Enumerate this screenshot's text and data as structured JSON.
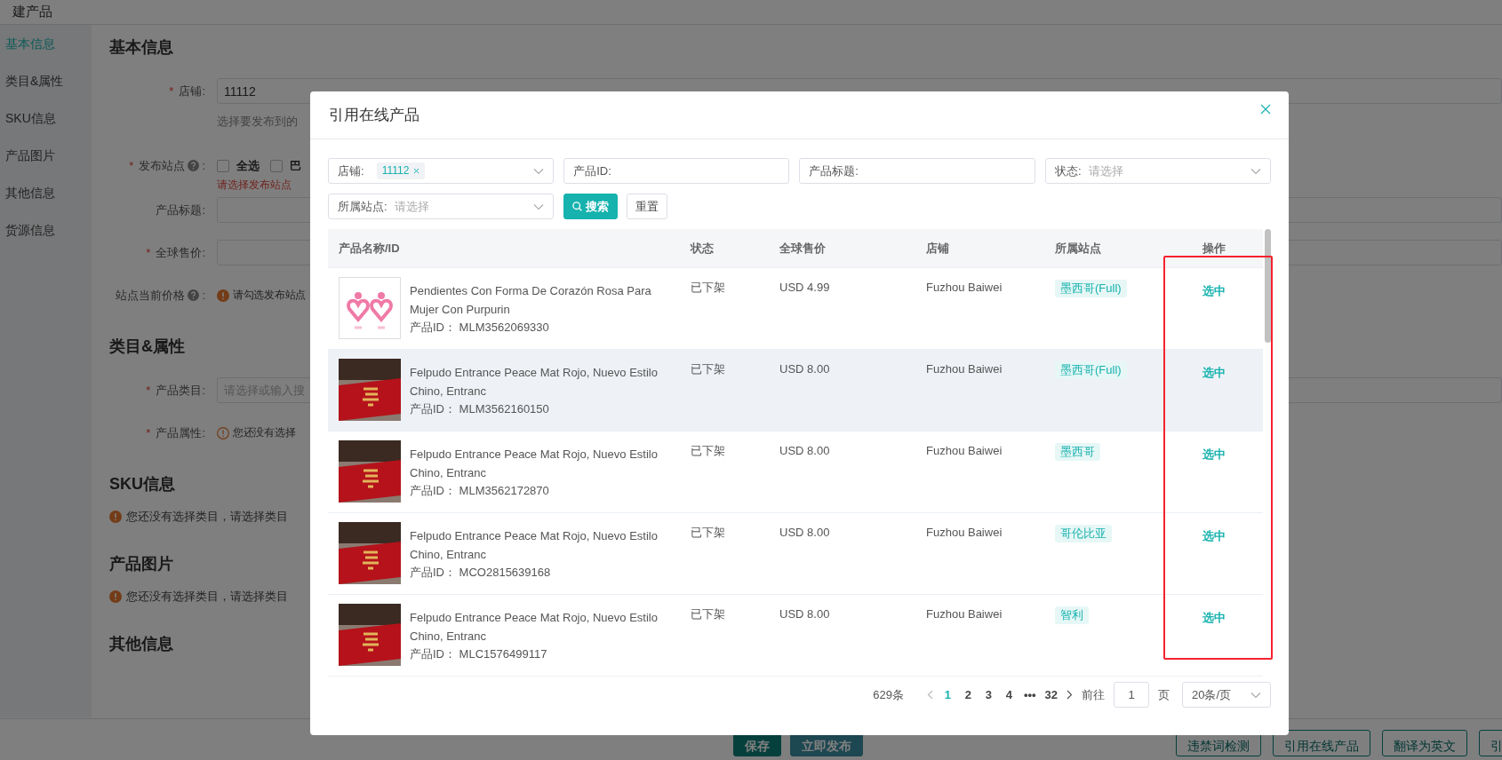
{
  "page": {
    "title": "建产品"
  },
  "sidebar": {
    "items": [
      {
        "label": "基本信息",
        "selected": true
      },
      {
        "label": "类目&属性",
        "selected": false
      },
      {
        "label": "SKU信息",
        "selected": false
      },
      {
        "label": "产品图片",
        "selected": false
      },
      {
        "label": "其他信息",
        "selected": false
      },
      {
        "label": "货源信息",
        "selected": false
      }
    ]
  },
  "form": {
    "sections": [
      {
        "title": "基本信息",
        "fields": [
          {
            "kind": "input",
            "mark": "*",
            "label": "店铺:",
            "help": false,
            "value": "11112",
            "hint": "选择要发布到的"
          },
          {
            "kind": "checkboxes",
            "mark": "*",
            "label": "发布站点",
            "help": true,
            "colon": ":",
            "options": [
              {
                "label": "全选",
                "checked": false
              },
              {
                "label": "巴",
                "checked": false
              }
            ],
            "error": "请选择发布站点"
          },
          {
            "kind": "input",
            "label": "产品标题:",
            "help": false
          },
          {
            "kind": "input",
            "mark": "*",
            "label": "全球售价:",
            "help": false
          },
          {
            "kind": "notice",
            "label": "站点当前价格",
            "help": true,
            "colon": ":",
            "text": "请勾选发布站点"
          }
        ]
      },
      {
        "title": "类目&属性",
        "fields": [
          {
            "kind": "input",
            "mark": "*",
            "label": "产品类目:",
            "help": false,
            "placeholder": "请选择或输入搜"
          },
          {
            "kind": "notice",
            "mark": "*",
            "label": "产品属性:",
            "help": false,
            "text": "您还没有选择"
          }
        ]
      },
      {
        "title": "SKU信息",
        "notice": "您还没有选择类目，请选择类目"
      },
      {
        "title": "产品图片",
        "notice": "您还没有选择类目，请选择类目"
      },
      {
        "title": "其他信息"
      }
    ]
  },
  "bottom_bar": {
    "buttons": [
      {
        "label": "保存",
        "kind": "primary"
      },
      {
        "label": "立即发布",
        "kind": "light"
      }
    ],
    "right_buttons": [
      {
        "label": "违禁词检测",
        "kind": "outline"
      },
      {
        "label": "引用在线产品",
        "kind": "outline"
      },
      {
        "label": "翻译为英文",
        "kind": "outline"
      },
      {
        "label": "引",
        "kind": "outline"
      }
    ]
  },
  "dialog": {
    "title": "引用在线产品",
    "filters": [
      {
        "kind": "select",
        "label": "店铺:",
        "tags": [
          "11112"
        ]
      },
      {
        "kind": "input",
        "label": "产品ID:"
      },
      {
        "kind": "input",
        "label": "产品标题:"
      },
      {
        "kind": "select",
        "label": "状态:",
        "placeholder": "请选择"
      },
      {
        "kind": "select",
        "label": "所属站点:",
        "placeholder": "请选择"
      }
    ],
    "buttons": [
      {
        "label": "搜索",
        "kind": "primary"
      },
      {
        "label": "重置",
        "kind": "default"
      }
    ],
    "table": {
      "columns": [
        "产品名称/ID",
        "状态",
        "全球售价",
        "店铺",
        "所属站点",
        "操作"
      ],
      "rows": [
        {
          "name": "Pendientes Con Forma De Corazón Rosa Para Mujer Con Purpurin",
          "id_line": "产品ID： MLM3562069330",
          "status": "已下架",
          "price": "USD 4.99",
          "store": "Fuzhou Baiwei",
          "site": "墨西哥(Full)",
          "action": "选中",
          "highlighted": false
        },
        {
          "name": "Felpudo Entrance Peace Mat Rojo, Nuevo Estilo Chino, Entranc",
          "id_line": "产品ID： MLM3562160150",
          "status": "已下架",
          "price": "USD 8.00",
          "store": "Fuzhou Baiwei",
          "site": "墨西哥(Full)",
          "action": "选中",
          "highlighted": true
        },
        {
          "name": "Felpudo Entrance Peace Mat Rojo, Nuevo Estilo Chino, Entranc",
          "id_line": "产品ID： MLM3562172870",
          "status": "已下架",
          "price": "USD 8.00",
          "store": "Fuzhou Baiwei",
          "site": "墨西哥",
          "action": "选中",
          "highlighted": false
        },
        {
          "name": "Felpudo Entrance Peace Mat Rojo, Nuevo Estilo Chino, Entranc",
          "id_line": "产品ID： MCO2815639168",
          "status": "已下架",
          "price": "USD 8.00",
          "store": "Fuzhou Baiwei",
          "site": "哥伦比亚",
          "action": "选中",
          "highlighted": false
        },
        {
          "name": "Felpudo Entrance Peace Mat Rojo, Nuevo Estilo Chino, Entranc",
          "id_line": "产品ID： MLC1576499117",
          "status": "已下架",
          "price": "USD 8.00",
          "store": "Fuzhou Baiwei",
          "site": "智利",
          "action": "选中",
          "highlighted": false
        }
      ]
    },
    "pagination": {
      "total": "629条",
      "pages": [
        {
          "label": "1",
          "selected": true
        },
        {
          "label": "2",
          "selected": false
        },
        {
          "label": "3",
          "selected": false
        },
        {
          "label": "4",
          "selected": false
        },
        {
          "label": "•••",
          "selected": false
        },
        {
          "label": "32",
          "selected": false
        }
      ],
      "goto_label": "前往",
      "goto_value": "1",
      "page_unit": "页",
      "page_size": "20条/页"
    }
  }
}
